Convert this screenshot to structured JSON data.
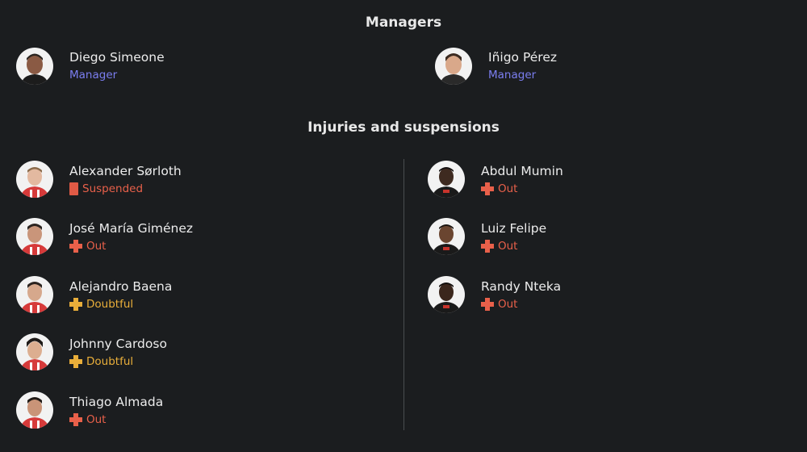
{
  "managers": {
    "title": "Managers",
    "items": [
      {
        "name": "Diego Simeone",
        "role": "Manager"
      },
      {
        "name": "Iñigo Pérez",
        "role": "Manager"
      }
    ]
  },
  "injuries": {
    "title": "Injuries and suspensions",
    "left": [
      {
        "name": "Alexander Sørloth",
        "status": "Suspended",
        "icon": "red-card-icon",
        "color": "#e8604a"
      },
      {
        "name": "José María Giménez",
        "status": "Out",
        "icon": "injury-cross-icon",
        "color": "#e8604a"
      },
      {
        "name": "Alejandro Baena",
        "status": "Doubtful",
        "icon": "injury-cross-icon",
        "color": "#e9ae3a"
      },
      {
        "name": "Johnny Cardoso",
        "status": "Doubtful",
        "icon": "injury-cross-icon",
        "color": "#e9ae3a"
      },
      {
        "name": "Thiago Almada",
        "status": "Out",
        "icon": "injury-cross-icon",
        "color": "#e8604a"
      }
    ],
    "right": [
      {
        "name": "Abdul Mumin",
        "status": "Out",
        "icon": "injury-cross-icon",
        "color": "#e8604a"
      },
      {
        "name": "Luiz Felipe",
        "status": "Out",
        "icon": "injury-cross-icon",
        "color": "#e8604a"
      },
      {
        "name": "Randy Nteka",
        "status": "Out",
        "icon": "injury-cross-icon",
        "color": "#e8604a"
      }
    ]
  }
}
